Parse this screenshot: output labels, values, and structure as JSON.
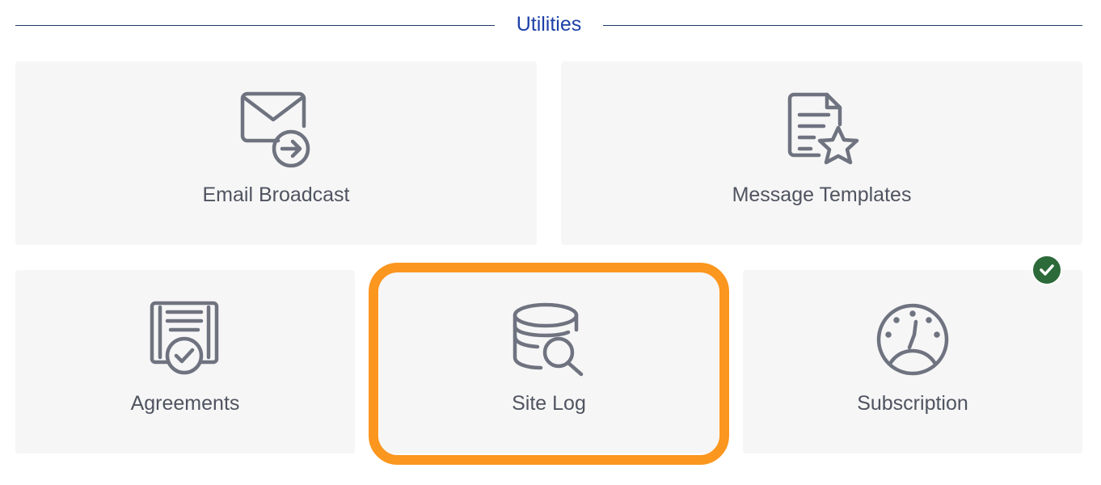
{
  "section": {
    "title": "Utilities"
  },
  "tiles": [
    {
      "label": "Email Broadcast",
      "icon": "envelope-arrow-icon"
    },
    {
      "label": "Message Templates",
      "icon": "document-star-icon"
    },
    {
      "label": "Agreements",
      "icon": "certificate-check-icon"
    },
    {
      "label": "Site Log",
      "icon": "database-search-icon"
    },
    {
      "label": "Subscription",
      "icon": "gauge-icon"
    }
  ],
  "highlight": {
    "target": "Site Log",
    "color": "#fb961f"
  },
  "badge": {
    "icon": "checkmark-icon",
    "color": "#2d6a3a"
  },
  "colors": {
    "title": "#1e40a8",
    "icon": "#6f7380",
    "label": "#4f5460",
    "tile_bg": "#f6f6f6"
  }
}
